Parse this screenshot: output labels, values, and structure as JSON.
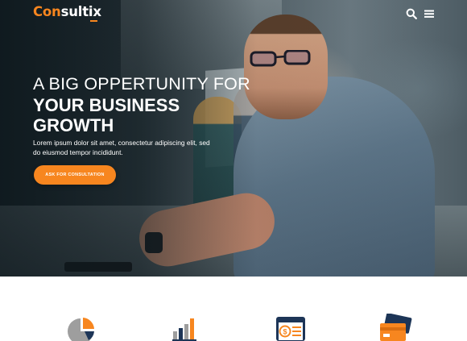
{
  "header": {
    "logo_part1": "Con",
    "logo_part2": "sultix",
    "icons": [
      "search-icon",
      "menu-icon"
    ]
  },
  "hero": {
    "line1": "A BIG OPPERTUNITY FOR",
    "line2": "YOUR BUSINESS",
    "line3": "GROWTH",
    "description": "Lorem ipsum dolor sit amet, consectetur adipiscing elit, sed do eiusmod tempor incididunt.",
    "cta_label": "ASK FOR CONSULTATION"
  },
  "services": {
    "icons": [
      "pie-chart-icon",
      "bar-chart-icon",
      "invoice-icon",
      "credit-card-icon"
    ]
  },
  "colors": {
    "accent": "#f7861f",
    "navy": "#1d3557",
    "gray": "#9e9e9e"
  }
}
